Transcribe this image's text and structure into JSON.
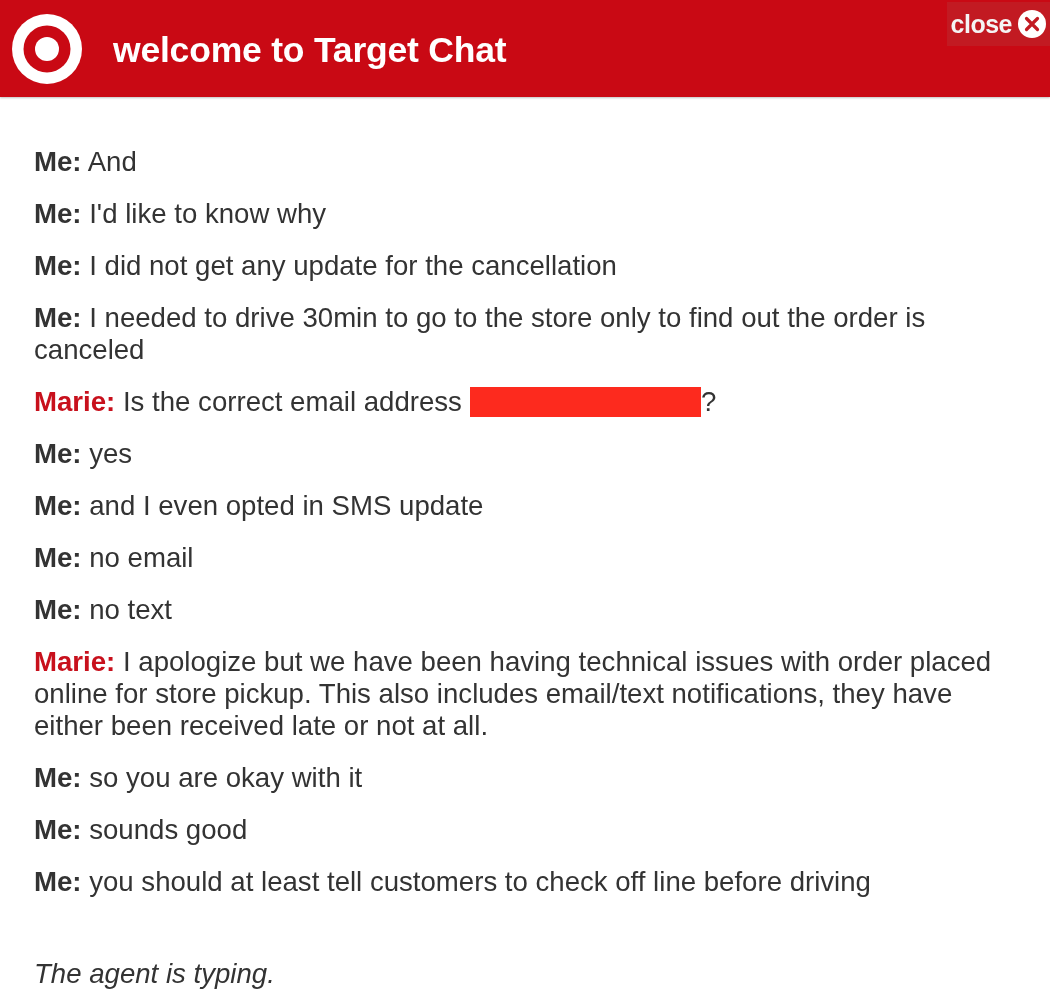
{
  "header": {
    "title": "welcome to Target Chat",
    "close_label": "close"
  },
  "messages": [
    {
      "sender": "Me:",
      "kind": "customer",
      "text": "And",
      "redacted": false
    },
    {
      "sender": "Me:",
      "kind": "customer",
      "text": "I'd like to know why",
      "redacted": false
    },
    {
      "sender": "Me:",
      "kind": "customer",
      "text": "I did not get any update for the cancellation",
      "redacted": false
    },
    {
      "sender": "Me:",
      "kind": "customer",
      "text": "I needed to drive 30min to go to the store only to find out the order is canceled",
      "redacted": false
    },
    {
      "sender": "Marie:",
      "kind": "agent",
      "text": "Is the correct email address",
      "redacted": true,
      "text_after": "?"
    },
    {
      "sender": "Me:",
      "kind": "customer",
      "text": "yes",
      "redacted": false
    },
    {
      "sender": "Me:",
      "kind": "customer",
      "text": "and I even opted in SMS update",
      "redacted": false
    },
    {
      "sender": "Me:",
      "kind": "customer",
      "text": "no email",
      "redacted": false
    },
    {
      "sender": "Me:",
      "kind": "customer",
      "text": "no text",
      "redacted": false
    },
    {
      "sender": "Marie:",
      "kind": "agent",
      "text": "I apologize but we have been having technical issues with order placed online for store pickup. This also includes email/text notifications, they have either been received late or not at all.",
      "redacted": false
    },
    {
      "sender": "Me:",
      "kind": "customer",
      "text": "so you are okay with it",
      "redacted": false
    },
    {
      "sender": "Me:",
      "kind": "customer",
      "text": "sounds good",
      "redacted": false
    },
    {
      "sender": "Me:",
      "kind": "customer",
      "text": "you should at least tell customers to check off line before driving",
      "redacted": false
    }
  ],
  "status": "The agent is typing."
}
